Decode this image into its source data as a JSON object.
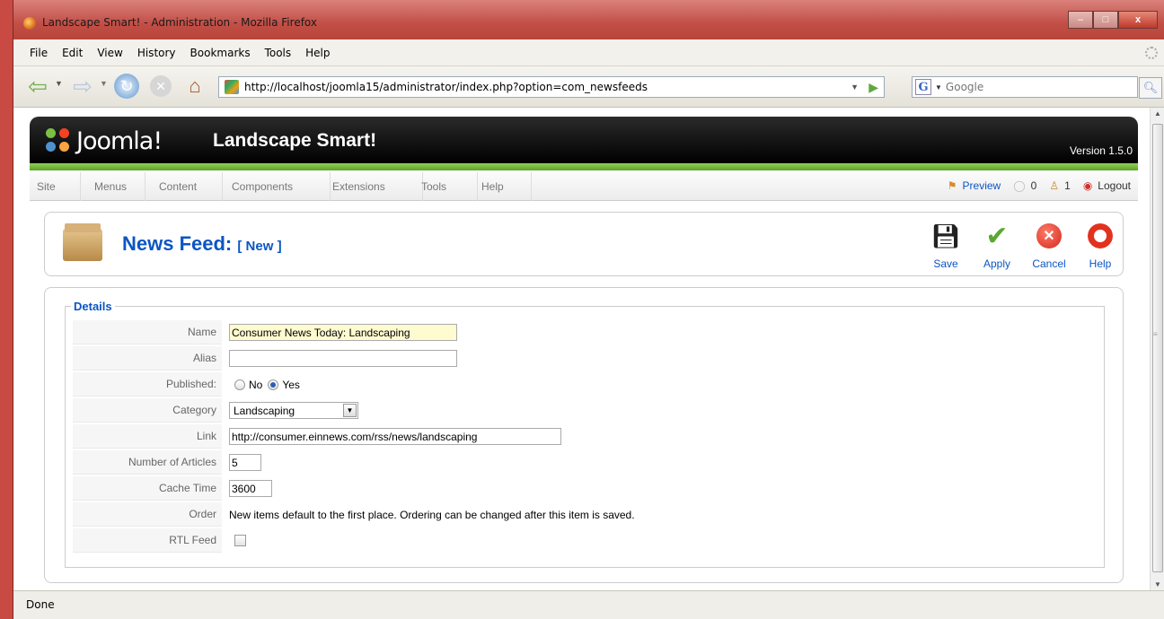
{
  "window": {
    "title": "Landscape Smart! - Administration - Mozilla Firefox",
    "controls": {
      "minimize": "–",
      "maximize": "□",
      "close": "x"
    }
  },
  "menubar": {
    "items": [
      {
        "label": "File"
      },
      {
        "label": "Edit"
      },
      {
        "label": "View"
      },
      {
        "label": "History"
      },
      {
        "label": "Bookmarks"
      },
      {
        "label": "Tools"
      },
      {
        "label": "Help"
      }
    ]
  },
  "navbar": {
    "url": "http://localhost/joomla15/administrator/index.php?option=com_newsfeeds",
    "search_placeholder": "Google",
    "search_engine_letter": "G"
  },
  "joomla": {
    "logo_text": "Joomla!",
    "site_name": "Landscape Smart!",
    "version": "Version 1.5.0",
    "menu": [
      {
        "label": "Site"
      },
      {
        "label": "Menus"
      },
      {
        "label": "Content"
      },
      {
        "label": "Components"
      },
      {
        "label": "Extensions"
      },
      {
        "label": "Tools"
      },
      {
        "label": "Help"
      }
    ],
    "preview_label": "Preview",
    "messages_count": "0",
    "users_count": "1",
    "logout_label": "Logout"
  },
  "toolbar": {
    "title": "News Feed:",
    "subtitle": "[ New ]",
    "buttons": {
      "save": "Save",
      "apply": "Apply",
      "cancel": "Cancel",
      "help": "Help"
    }
  },
  "form": {
    "legend": "Details",
    "labels": {
      "name": "Name",
      "alias": "Alias",
      "published": "Published:",
      "category": "Category",
      "link": "Link",
      "num_articles": "Number of Articles",
      "cache_time": "Cache Time",
      "order": "Order",
      "rtl": "RTL Feed"
    },
    "values": {
      "name": "Consumer News Today: Landscaping",
      "alias": "",
      "published_no": "No",
      "published_yes": "Yes",
      "published_selected": "Yes",
      "category": "Landscaping",
      "link": "http://consumer.einnews.com/rss/news/landscaping",
      "num_articles": "5",
      "cache_time": "3600",
      "order_text": "New items default to the first place. Ordering can be changed after this item is saved.",
      "rtl_checked": false
    }
  },
  "statusbar": {
    "text": "Done"
  },
  "colors": {
    "joomla_blue": "#0b55c4",
    "joomla_green": "#6aad31",
    "titlebar_red": "#c24f46"
  }
}
